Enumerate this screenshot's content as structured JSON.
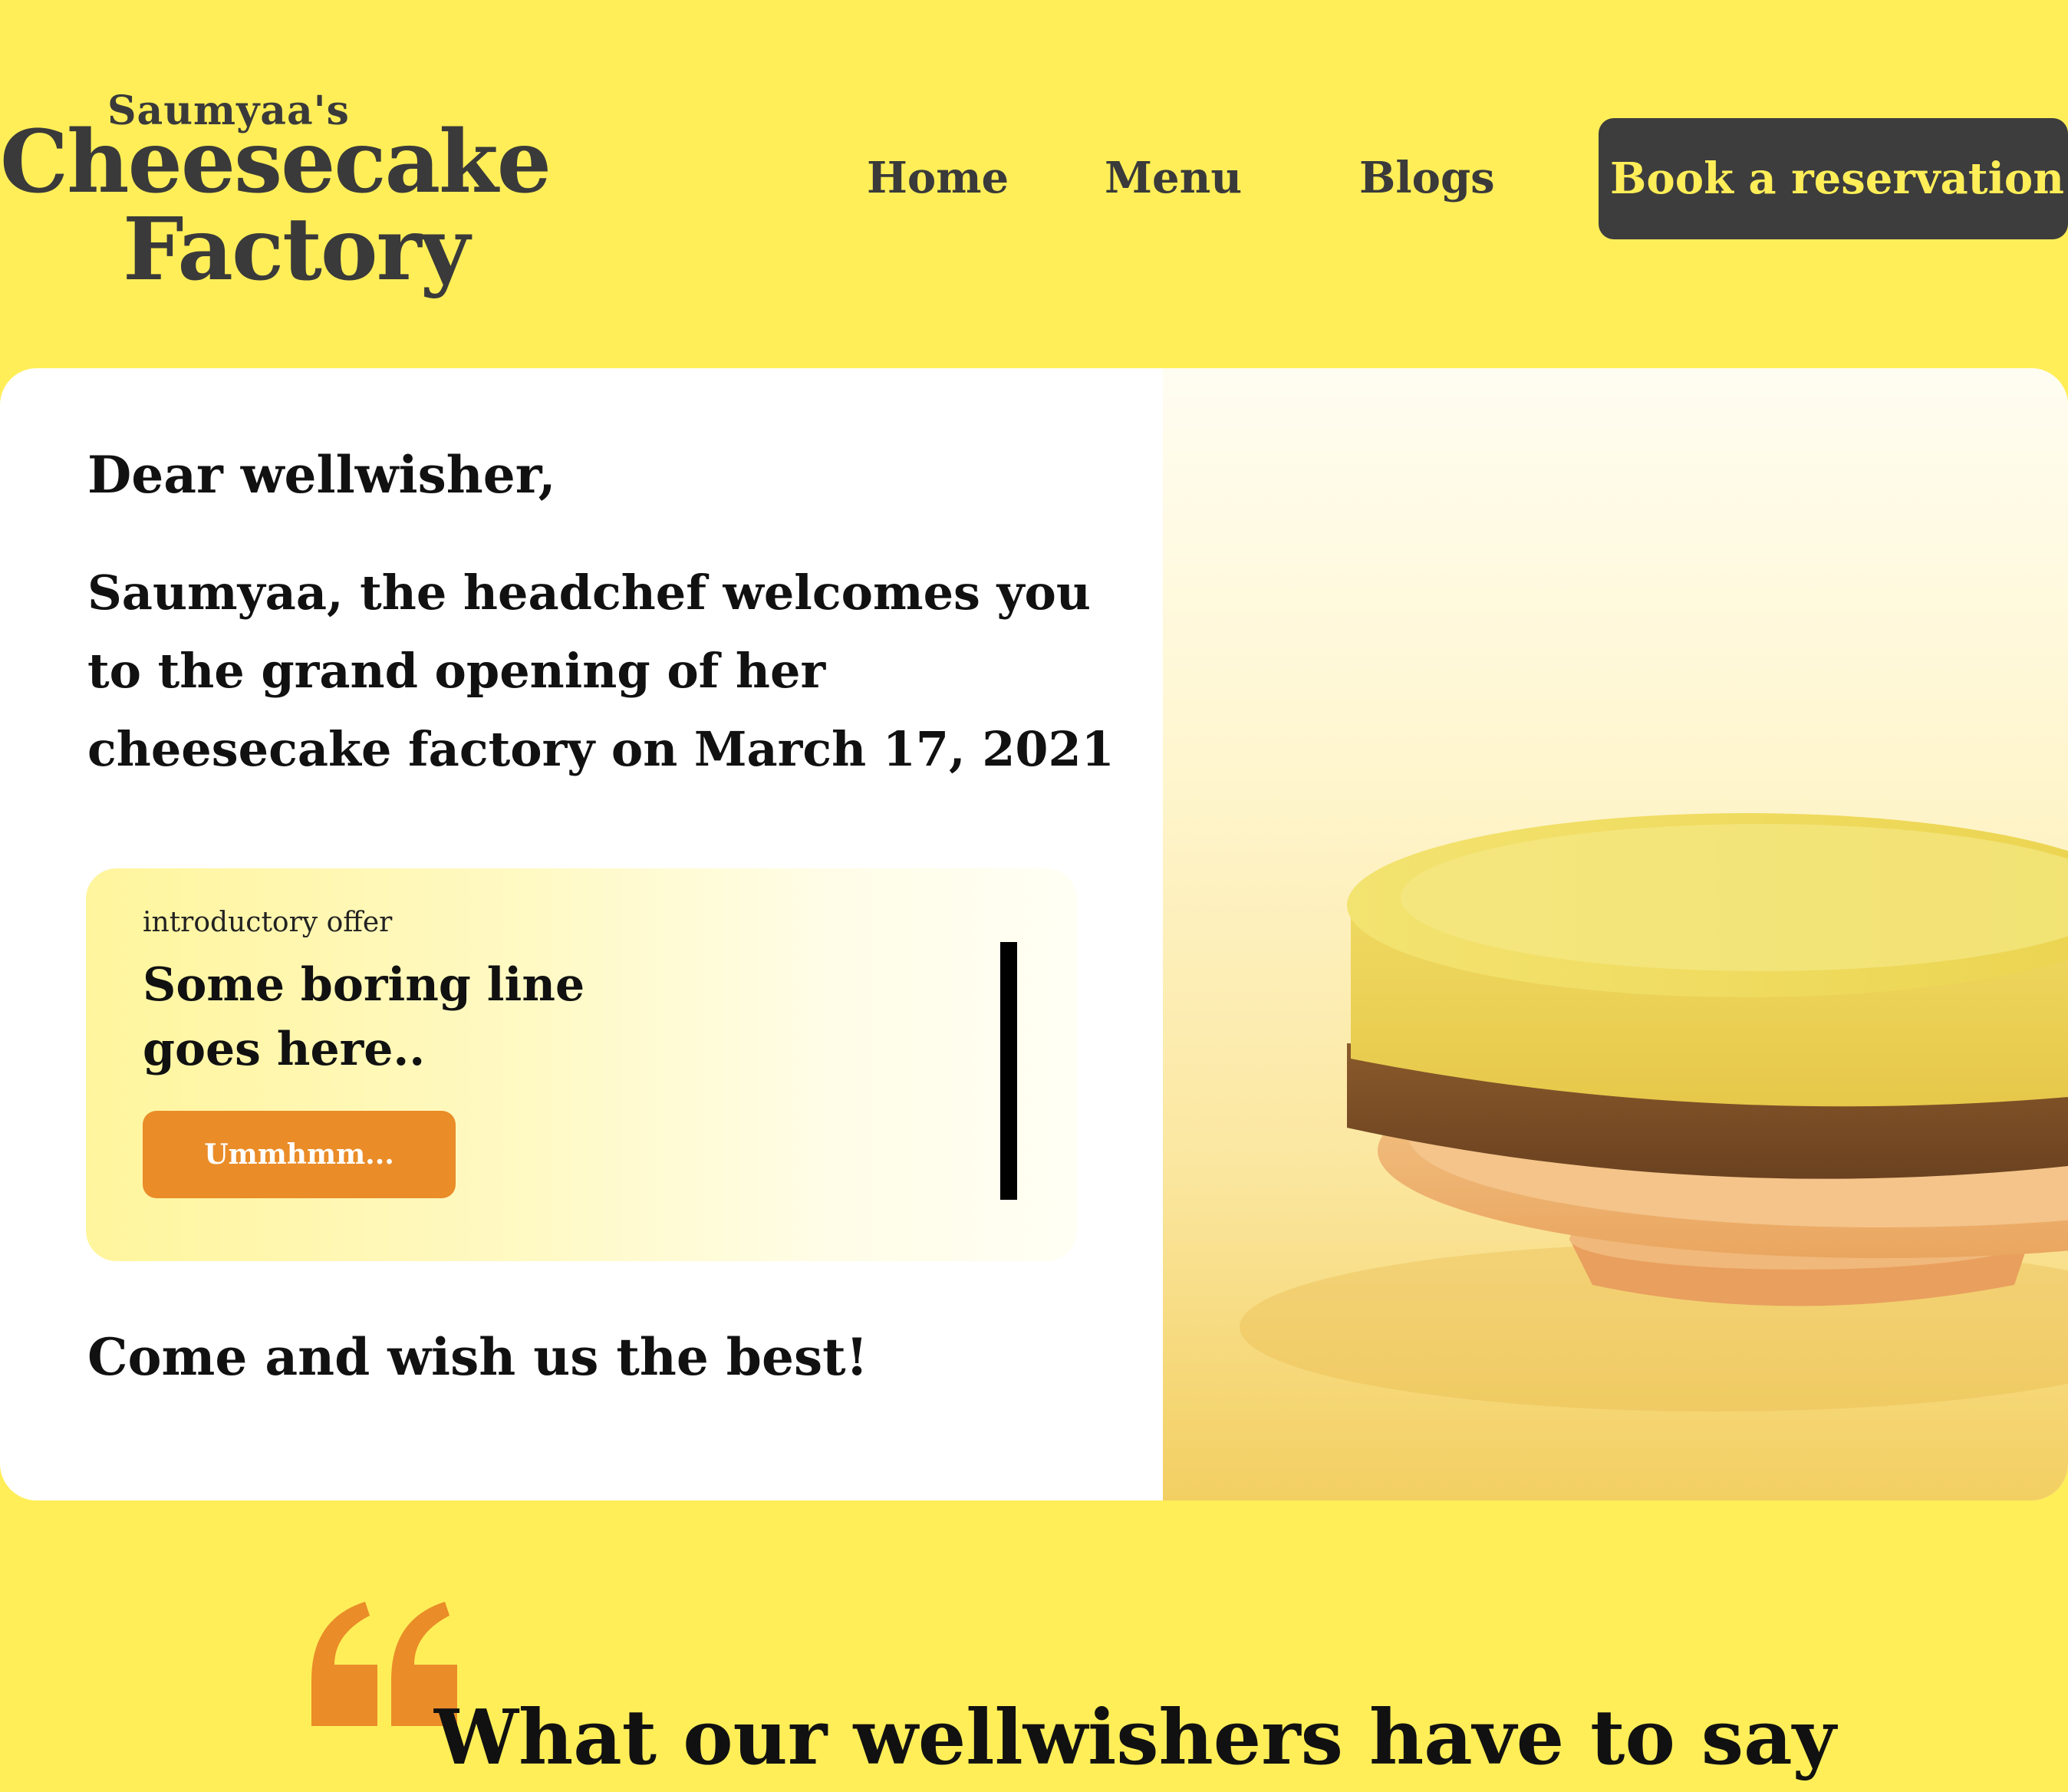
{
  "brand": {
    "line1": "Saumyaa's",
    "line2": "Cheesecake",
    "line3": "Factory"
  },
  "nav": {
    "items": [
      {
        "label": "Home"
      },
      {
        "label": "Menu"
      },
      {
        "label": "Blogs"
      }
    ],
    "cta_label": "Book a reservation"
  },
  "hero": {
    "greeting": "Dear wellwisher,",
    "intro": "Saumyaa, the headchef welcomes you to the grand opening of her cheesecake factory on March 17, 2021",
    "offer": {
      "label": "introductory offer",
      "title": "Some boring line goes here..",
      "button_label": "Ummhmm..."
    },
    "closing": "Come and wish us the best!"
  },
  "testimonials": {
    "title": "What our wellwishers have to say"
  },
  "colors": {
    "background": "#FFEE58",
    "dark": "#3D3D3D",
    "accent_orange": "#EA8C28",
    "card": "#FFFFFF"
  },
  "icons": {
    "quote": "open-quote-icon",
    "hero_image": "cheesecake-photo"
  }
}
